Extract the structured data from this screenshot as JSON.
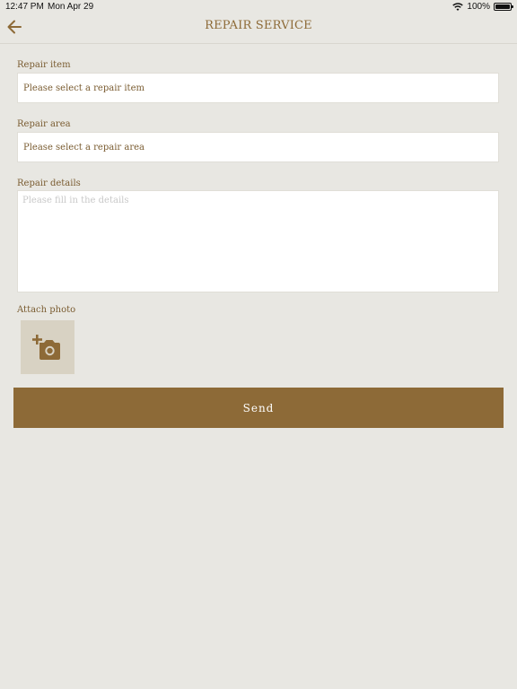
{
  "status_bar": {
    "time": "12:47 PM",
    "date": "Mon Apr 29",
    "battery": "100%"
  },
  "header": {
    "title": "REPAIR SERVICE",
    "back_icon": "arrow-left-icon"
  },
  "form": {
    "repair_item": {
      "label": "Repair item",
      "value": "Please select a repair item"
    },
    "repair_area": {
      "label": "Repair area",
      "value": "Please select a repair area"
    },
    "repair_details": {
      "label": "Repair details",
      "placeholder": "Please fill in the details"
    },
    "attach_photo": {
      "label": "Attach photo",
      "icon": "add-camera-icon"
    },
    "send_label": "Send"
  },
  "colors": {
    "accent": "#8d6a37",
    "background": "#e8e7e2",
    "photo_tile": "#d8d2c3"
  }
}
